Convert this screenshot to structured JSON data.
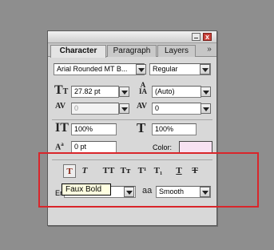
{
  "palette": {
    "tabs": [
      {
        "label": "Character",
        "active": true
      },
      {
        "label": "Paragraph",
        "active": false
      },
      {
        "label": "Layers",
        "active": false
      }
    ],
    "panel_menu_icon": "»",
    "close_glyph": "x",
    "font_family": "Arial Rounded MT B...",
    "font_style": "Regular",
    "font_size": "27.82 pt",
    "leading": "(Auto)",
    "kerning": "0",
    "tracking": "0",
    "vertical_scale": "100%",
    "horizontal_scale": "100%",
    "baseline_shift": "0 pt",
    "color_label": "Color:",
    "color_swatch": "#f7e2f2",
    "style_buttons": [
      {
        "name": "faux-bold-button",
        "glyph": "T",
        "pressed": true
      },
      {
        "name": "faux-italic-button",
        "glyph": "T"
      },
      {
        "name": "all-caps-button",
        "glyph": "TT"
      },
      {
        "name": "small-caps-button",
        "glyph": "Tт"
      },
      {
        "name": "superscript-button",
        "glyph": "T¹"
      },
      {
        "name": "subscript-button",
        "glyph": "T₁"
      },
      {
        "name": "underline-button",
        "glyph": "T"
      },
      {
        "name": "strikethrough-button",
        "glyph": "T"
      }
    ],
    "language_prefix": "En",
    "antialias_icon": "aa",
    "antialias": "Smooth",
    "tooltip": "Faux Bold",
    "highlight_color": "#d9262b"
  }
}
